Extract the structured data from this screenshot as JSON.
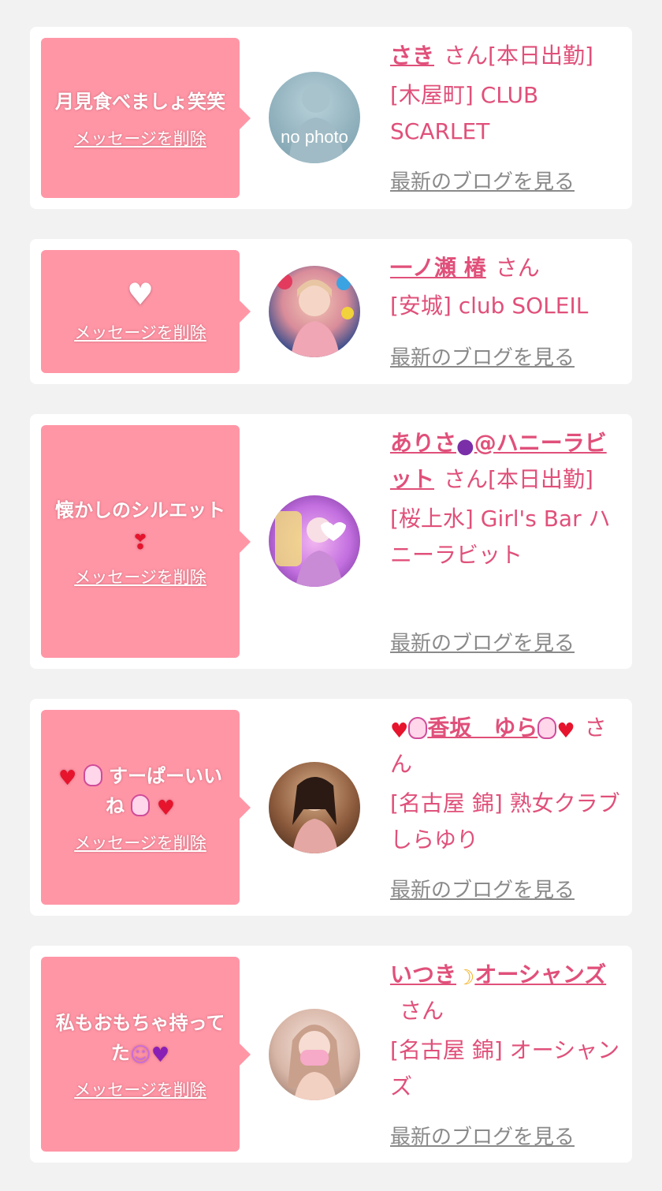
{
  "common": {
    "delete_label": "メッセージを削除",
    "blog_label": "最新のブログを見る",
    "san": "さん"
  },
  "cards": [
    {
      "message": "月見食べましょ笑笑",
      "avatar_text": "no photo",
      "name": "さき",
      "status": "[本日出勤]",
      "shop_line1": "[木屋町] CLUB",
      "shop_line2": "SCARLET"
    },
    {
      "message_icon": "white-heart-icon",
      "name": "一ノ瀬 椿",
      "shop": "[安城] club SOLEIL"
    },
    {
      "message": "懐かしのシルエット",
      "message_icon": "heart-exclamation-icon",
      "name_part1": "ありさ",
      "name_icon": "grapes-icon",
      "name_part2": "@ハニーラビット",
      "status": "[本日出勤]",
      "shop": "[桜上水] Girl's Bar ハニーラビット"
    },
    {
      "message": "すーぱーいいね",
      "message_icons": [
        "red-heart-icon",
        "bunny-icon",
        "bunny-icon",
        "red-heart-icon"
      ],
      "name": "香坂　ゆら",
      "name_icons": [
        "red-heart-icon",
        "bunny-icon",
        "bunny-icon",
        "red-heart-icon"
      ],
      "shop": "[名古屋 錦] 熟女クラブしらゆり"
    },
    {
      "message": "私もおもちゃ持ってた",
      "message_icons": [
        "laughing-face-icon",
        "purple-heart-icon"
      ],
      "name_part1": "いつき",
      "name_icon": "crescent-moon-icon",
      "name_part2": "オーシャンズ",
      "shop": "[名古屋 錦] オーシャンズ"
    }
  ],
  "colors": {
    "page_background": "#f2f2f2",
    "card_background": "#ffffff",
    "bubble": "#ff96a6",
    "accent_pink": "#e0507a",
    "link_gray": "#8a8a8a"
  }
}
